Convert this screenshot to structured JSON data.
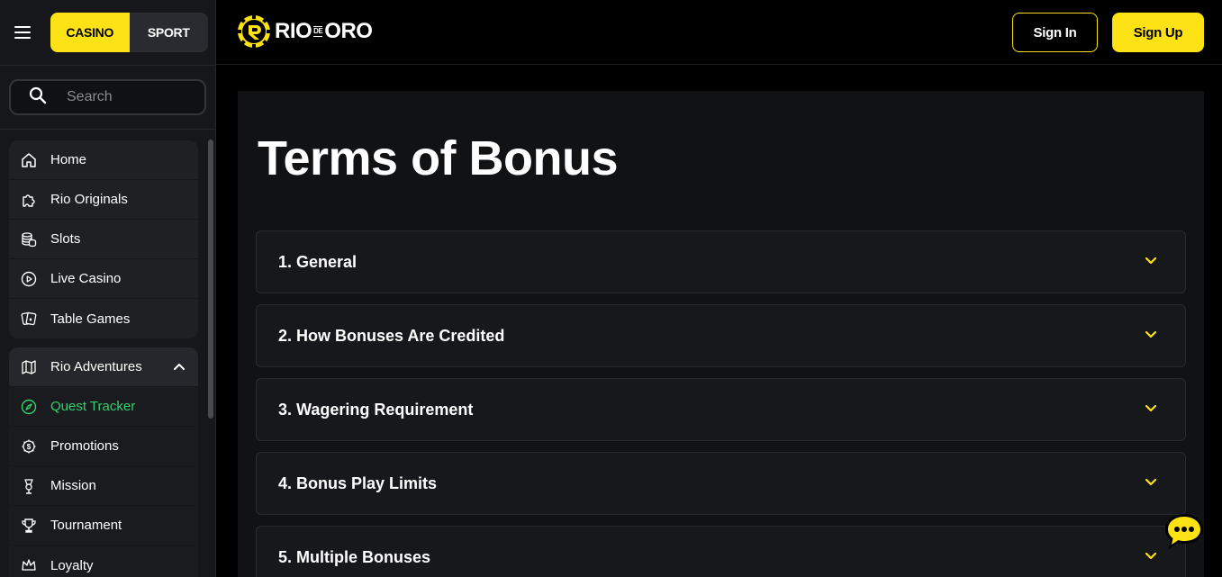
{
  "sidebar": {
    "toggle": {
      "casino": "CASINO",
      "sport": "SPORT"
    },
    "search": {
      "placeholder": "Search"
    },
    "main_items": [
      {
        "label": "Home",
        "icon": "home-icon"
      },
      {
        "label": "Rio Originals",
        "icon": "puzzle-icon"
      },
      {
        "label": "Slots",
        "icon": "coins-icon"
      },
      {
        "label": "Live Casino",
        "icon": "play-circle-icon"
      },
      {
        "label": "Table Games",
        "icon": "cards-icon"
      }
    ],
    "adventures": {
      "label": "Rio Adventures",
      "icon": "map-icon",
      "items": [
        {
          "label": "Quest Tracker",
          "icon": "compass-icon",
          "active": true
        },
        {
          "label": "Promotions",
          "icon": "dollar-gear-icon"
        },
        {
          "label": "Mission",
          "icon": "medal-icon"
        },
        {
          "label": "Tournament",
          "icon": "trophy-icon"
        },
        {
          "label": "Loyalty",
          "icon": "crown-icon"
        }
      ]
    }
  },
  "header": {
    "logo": {
      "part1": "RIO",
      "part2": "DE",
      "part3": "ORO"
    },
    "sign_in": "Sign In",
    "sign_up": "Sign Up"
  },
  "main": {
    "title": "Terms of Bonus",
    "sections": [
      {
        "label": "1. General"
      },
      {
        "label": "2. How Bonuses Are Credited"
      },
      {
        "label": "3. Wagering Requirement"
      },
      {
        "label": "4. Bonus Play Limits"
      },
      {
        "label": "5. Multiple Bonuses"
      }
    ]
  },
  "colors": {
    "accent": "#fde216",
    "active": "#31d16c",
    "background": "#000000",
    "panel": "#111214"
  }
}
